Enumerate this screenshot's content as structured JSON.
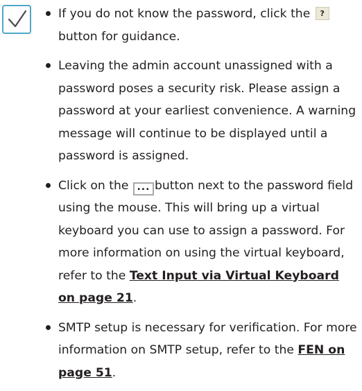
{
  "note": {
    "icon": "checkmark-icon",
    "border_color": "#4fa8c8",
    "check_color": "#4a4a4a"
  },
  "bullets": [
    {
      "before": "If you do not know the password, click the ",
      "button_label": "?",
      "after": " button for guidance."
    },
    {
      "text": "Leaving the admin account unassigned with a password poses a security risk. Please assign a password at your earliest convenience. A warning message will continue to be displayed until a password is assigned."
    },
    {
      "before": "Click on the ",
      "button_label": "...",
      "after": "button next to the password field using the mouse. This will bring up a virtual keyboard you can use to assign a password. For more information on using the virtual keyboard, refer to the ",
      "link": "Text Input via Virtual Keyboard on page 21",
      "end": "."
    },
    {
      "before": "SMTP setup is necessary for verification. For more information on SMTP setup, refer to the ",
      "link": "FEN on page 51",
      "end": "."
    }
  ]
}
